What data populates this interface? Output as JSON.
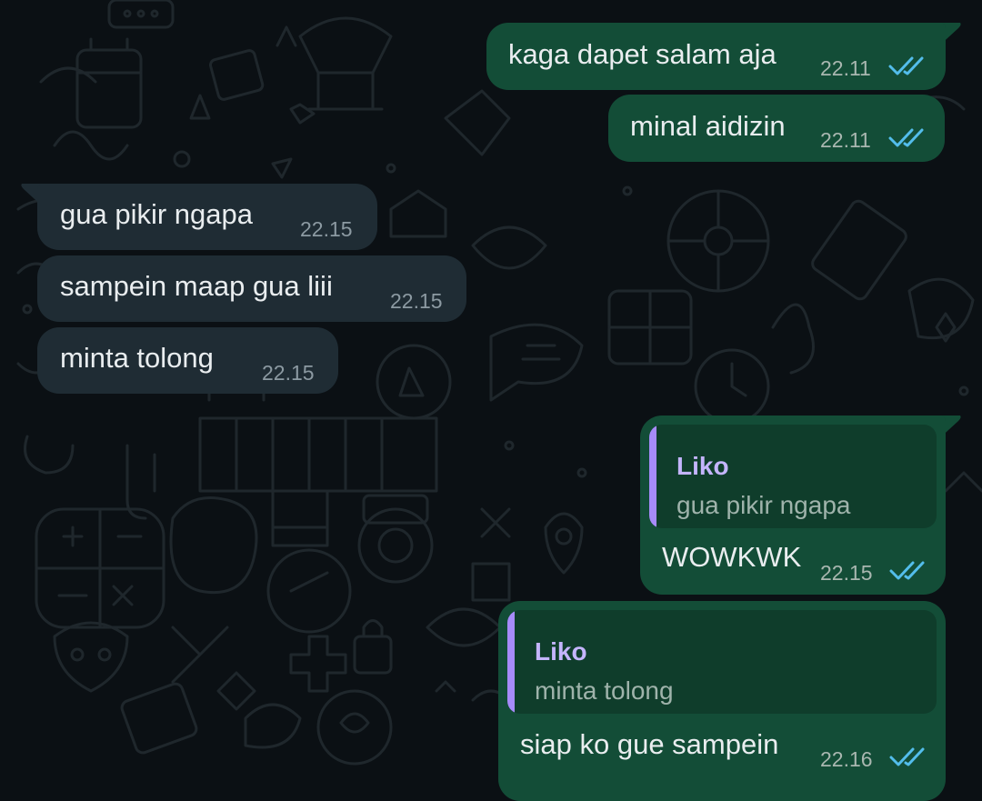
{
  "messages": [
    {
      "direction": "outgoing",
      "text": "kaga dapet salam aja",
      "time": "22.11",
      "status": "read",
      "status_icon": "double-check-icon"
    },
    {
      "direction": "outgoing",
      "text": "minal aidizin",
      "time": "22.11",
      "status": "read",
      "status_icon": "double-check-icon"
    },
    {
      "direction": "incoming",
      "text": "gua pikir ngapa",
      "time": "22.15"
    },
    {
      "direction": "incoming",
      "text": "sampein maap gua liii",
      "time": "22.15"
    },
    {
      "direction": "incoming",
      "text": "minta tolong",
      "time": "22.15"
    },
    {
      "direction": "outgoing",
      "text": "WOWKWK",
      "time": "22.15",
      "status": "read",
      "status_icon": "double-check-icon",
      "reply": {
        "sender": "Liko",
        "text": "gua pikir ngapa"
      }
    },
    {
      "direction": "outgoing",
      "text": "siap ko gue sampein",
      "time": "22.16",
      "status": "read",
      "status_icon": "double-check-icon",
      "reply": {
        "sender": "Liko",
        "text": "minta tolong"
      }
    }
  ],
  "colors": {
    "background": "#0b1014",
    "incoming_bubble": "#1f2c34",
    "outgoing_bubble": "#134d37",
    "read_ticks": "#53bdeb",
    "reply_accent": "#a78bfa"
  }
}
